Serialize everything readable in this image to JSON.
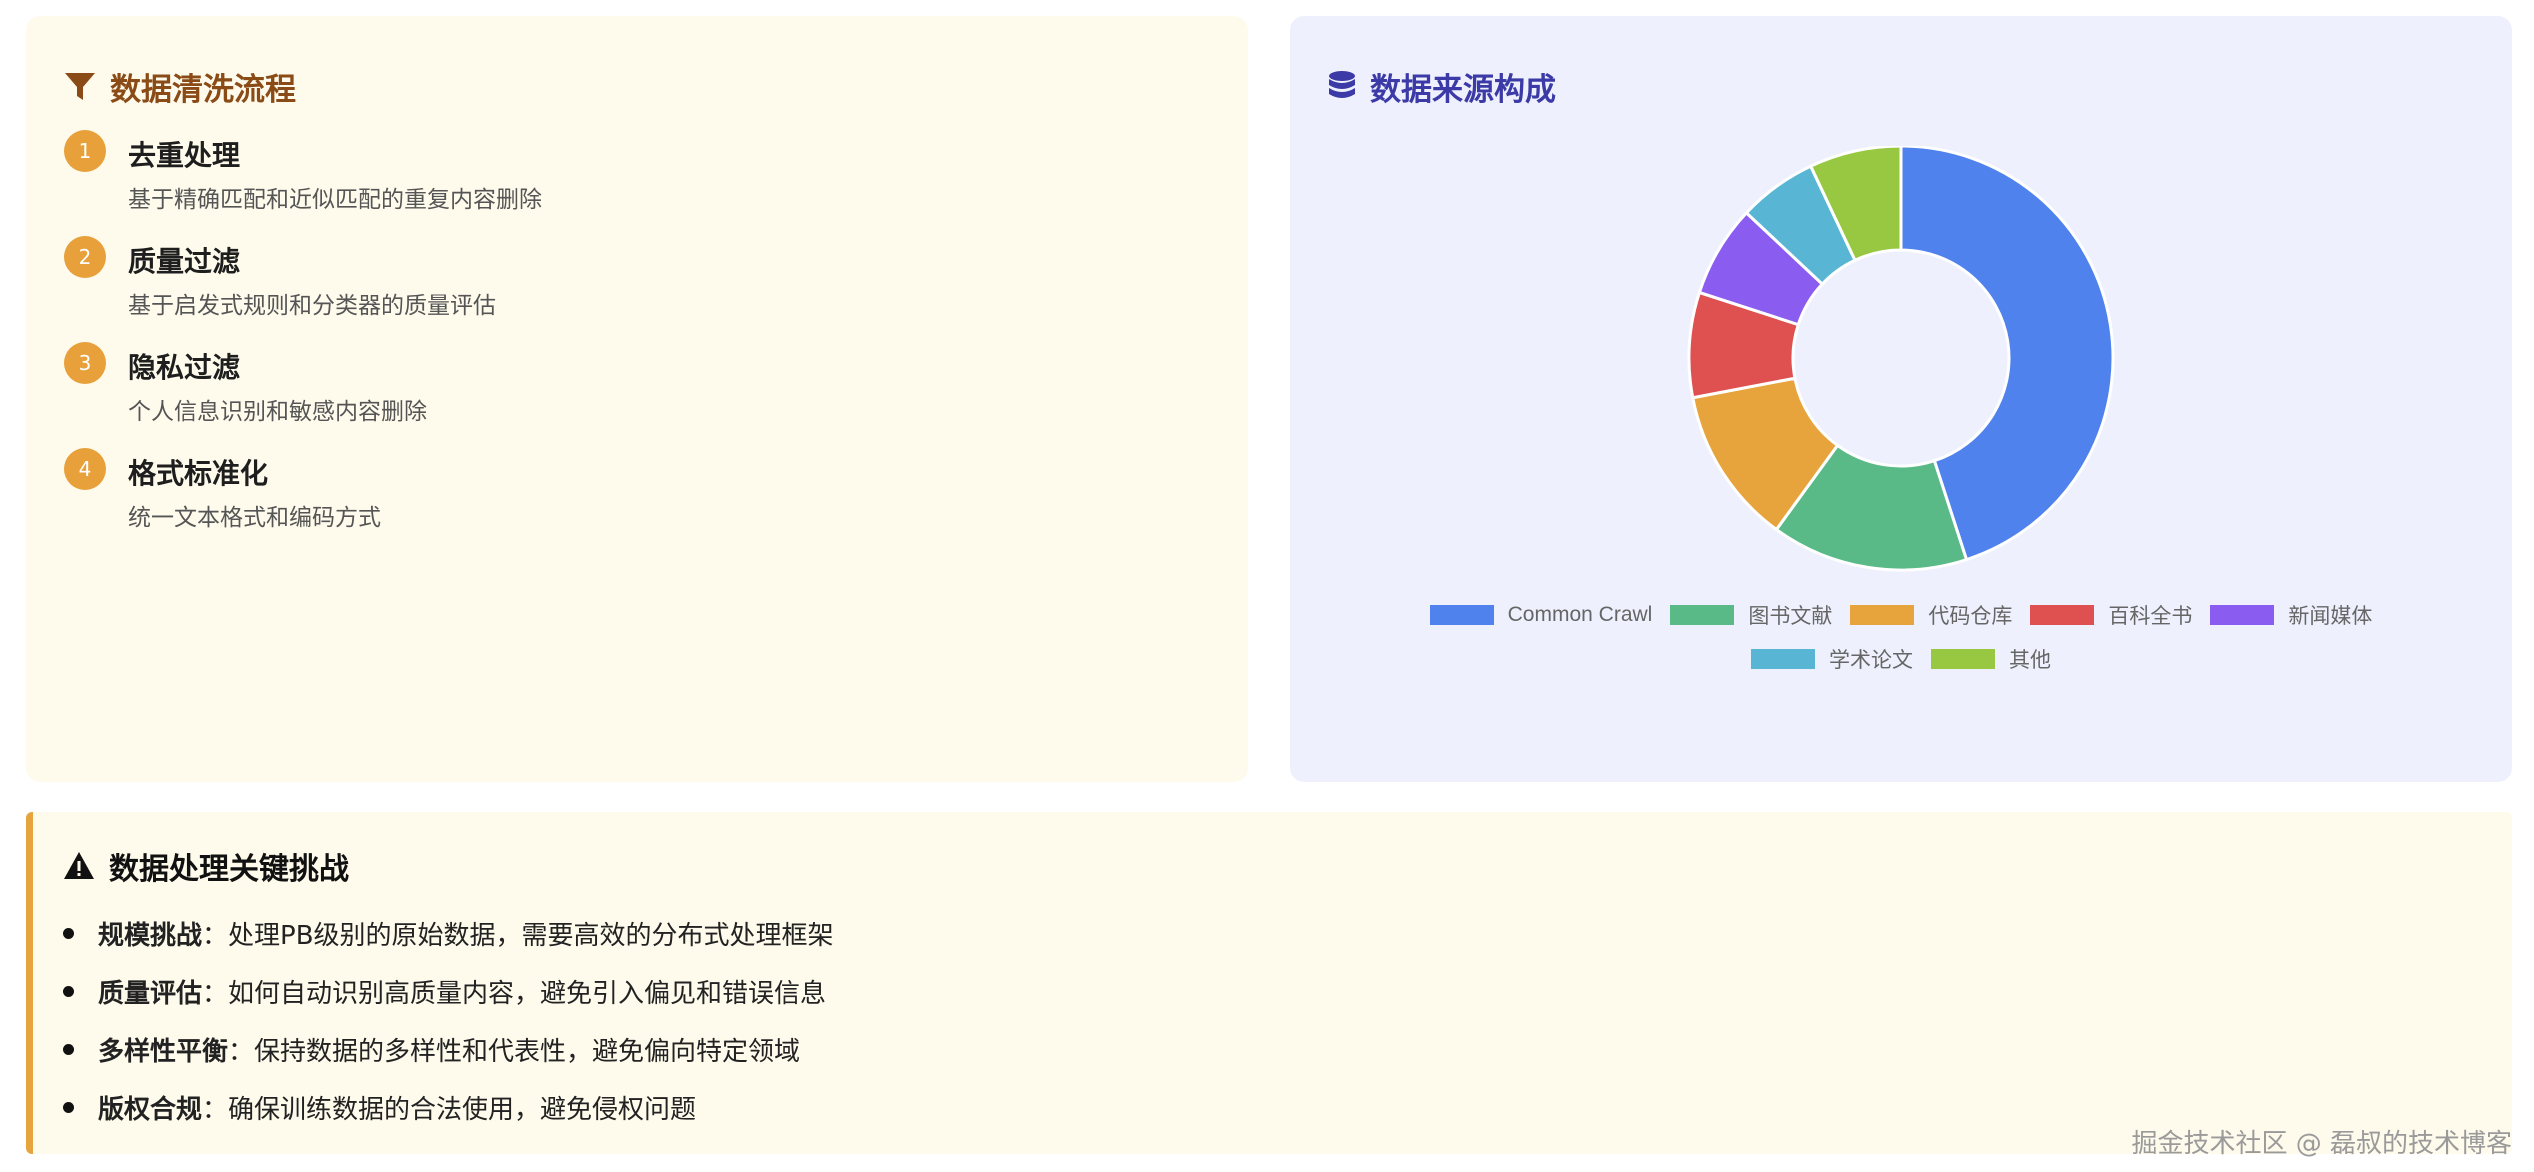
{
  "cleaning": {
    "title": "数据清洗流程",
    "steps": [
      {
        "num": "1",
        "title": "去重处理",
        "desc": "基于精确匹配和近似匹配的重复内容删除"
      },
      {
        "num": "2",
        "title": "质量过滤",
        "desc": "基于启发式规则和分类器的质量评估"
      },
      {
        "num": "3",
        "title": "隐私过滤",
        "desc": "个人信息识别和敏感内容删除"
      },
      {
        "num": "4",
        "title": "格式标准化",
        "desc": "统一文本格式和编码方式"
      }
    ]
  },
  "source": {
    "title": "数据来源构成"
  },
  "chart_data": {
    "type": "pie",
    "variant": "doughnut",
    "categories": [
      "Common Crawl",
      "图书文献",
      "代码仓库",
      "百科全书",
      "新闻媒体",
      "学术论文",
      "其他"
    ],
    "values": [
      45,
      15,
      12,
      8,
      7,
      6,
      7
    ],
    "colors": [
      "#5082ee",
      "#5aba87",
      "#e8a43c",
      "#df5151",
      "#8a5cef",
      "#58b6d4",
      "#98c842"
    ],
    "legend_position": "bottom"
  },
  "challenges": {
    "title": "数据处理关键挑战",
    "items": [
      {
        "label": "规模挑战",
        "sep": "：",
        "text": "处理PB级别的原始数据，需要高效的分布式处理框架"
      },
      {
        "label": "质量评估",
        "sep": "：",
        "text": "如何自动识别高质量内容，避免引入偏见和错误信息"
      },
      {
        "label": "多样性平衡",
        "sep": "：",
        "text": "保持数据的多样性和代表性，避免偏向特定领域"
      },
      {
        "label": "版权合规",
        "sep": "：",
        "text": "确保训练数据的合法使用，避免侵权问题"
      }
    ]
  },
  "watermark": "掘金技术社区 @ 磊叔的技术博客"
}
